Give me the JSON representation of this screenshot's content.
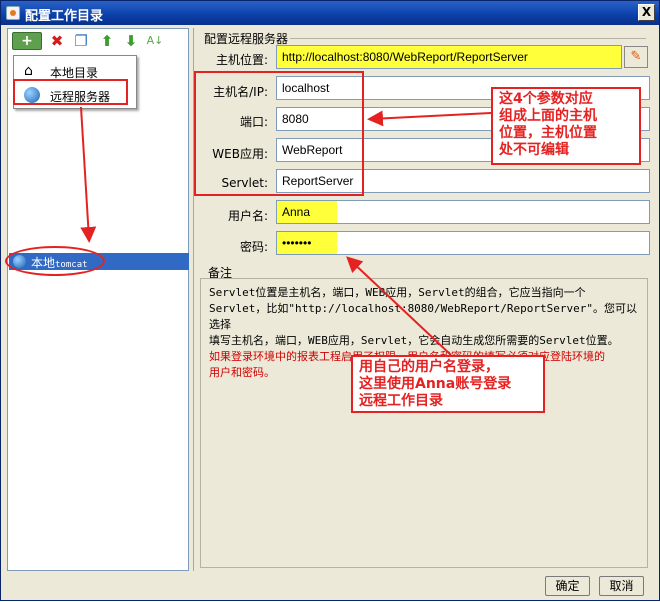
{
  "window": {
    "title": "配置工作目录",
    "close_label": "X"
  },
  "toolbar": {
    "add_icon": "+",
    "delete_icon": "✖",
    "copy_icon": "❐",
    "up_icon": "⬆",
    "down_icon": "⬇",
    "sort_icon": "A↓"
  },
  "dropdown": {
    "items": [
      {
        "label": "本地目录",
        "icon": "home-icon"
      },
      {
        "label": "远程服务器",
        "icon": "globe-icon"
      }
    ]
  },
  "tree": {
    "selected_label": "本地",
    "selected_suffix": "tomcat"
  },
  "form": {
    "group_title": "配置远程服务器",
    "host_label": "主机位置:",
    "host_value": "http://localhost:8080/WebReport/ReportServer",
    "hostname_label": "主机名/IP:",
    "hostname_value": "localhost",
    "port_label": "端口:",
    "port_value": "8080",
    "webapp_label": "WEB应用:",
    "webapp_value": "WebReport",
    "servlet_label": "Servlet:",
    "servlet_value": "ReportServer",
    "username_label": "用户名:",
    "username_value": "Anna",
    "password_label": "密码:",
    "password_value": "•••••••"
  },
  "memo": {
    "label": "备注",
    "line1": "Servlet位置是主机名，端口，WEB应用，Servlet的组合，它应当指向一个",
    "line2": "Servlet，比如\"http://localhost:8080/WebReport/ReportServer\"。您可以选择",
    "line3": "填写主机名，端口，WEB应用，Servlet，它会自动生成您所需要的Servlet位置。",
    "red1": "如果登录环境中的报表工程启用了权限，用户名和密码的填写必须对应登陆环境的",
    "red2": "用户和密码。"
  },
  "buttons": {
    "ok_label": "确定",
    "cancel_label": "取消"
  },
  "annotations": {
    "note1_line1": "这4个参数对应",
    "note1_line2": "组成上面的主机",
    "note1_line3": "位置，主机位置",
    "note1_line4": "处不可编辑",
    "note2_line1": "用自己的用户名登录，",
    "note2_line2": "这里使用Anna账号登录",
    "note2_line3": "远程工作目录"
  },
  "colors": {
    "accent_red": "#e52222",
    "highlight": "#ffff3a",
    "selection": "#316ac5"
  }
}
